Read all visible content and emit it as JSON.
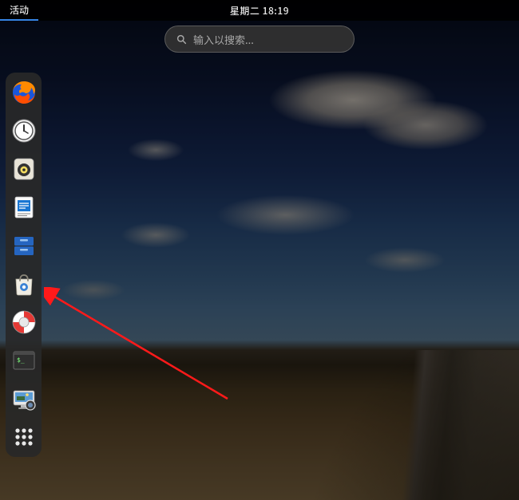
{
  "topbar": {
    "activities_label": "活动",
    "clock": "星期二 18:19"
  },
  "search": {
    "placeholder": "输入以搜索..."
  },
  "dash": {
    "apps": [
      {
        "name": "firefox"
      },
      {
        "name": "clock"
      },
      {
        "name": "rhythmbox"
      },
      {
        "name": "libreoffice-writer"
      },
      {
        "name": "files-drawer"
      },
      {
        "name": "software-center"
      },
      {
        "name": "help"
      },
      {
        "name": "terminal"
      },
      {
        "name": "screenshot"
      }
    ],
    "show_apps_label": "显示应用程序"
  },
  "annotation": {
    "color": "#ff1a1a"
  }
}
